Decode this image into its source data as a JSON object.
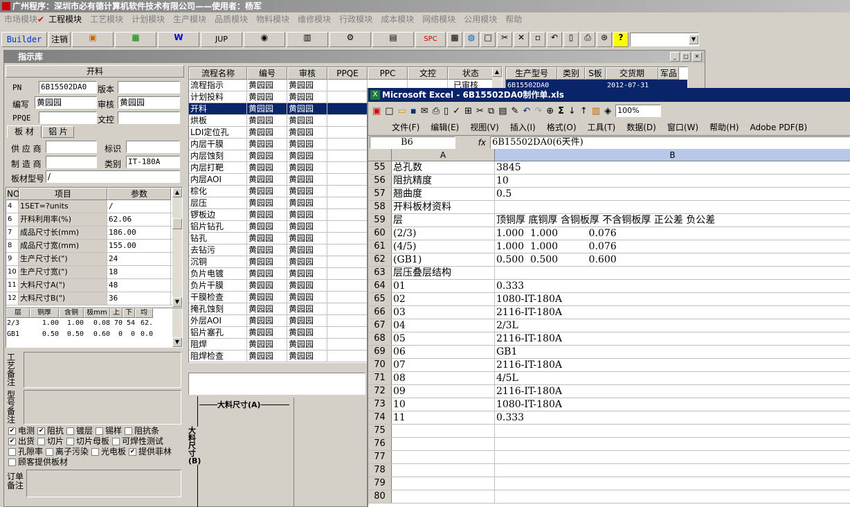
{
  "app": {
    "title": "广州程序：深圳市必有德计算机软件技术有限公司——使用者：杨军"
  },
  "menu": [
    "市场模块",
    "工程模块",
    "工艺模块",
    "计划模块",
    "生产模块",
    "品质模块",
    "物料模块",
    "维修模块",
    "行政模块",
    "成本模块",
    "网络模块",
    "公用模块",
    "帮助"
  ],
  "toolbar": {
    "builder": "Builder",
    "logout": "注销",
    "jup": "JUP",
    "spc": "SPC"
  },
  "lib": {
    "title": "指示库",
    "section": "开料",
    "pn_label": "PN",
    "pn_value": "6B15502DA0",
    "version_label": "版本",
    "author_label": "编写",
    "author_value": "黄园园",
    "review_label": "审核",
    "review_value": "黄园园",
    "ppqe_label": "PPQE",
    "doc_label": "文控",
    "tab1": "板 材",
    "tab2": "铝 片",
    "supplier_label": "供 应 商",
    "mark_label": "标识",
    "maker_label": "制 造 商",
    "class_label": "类别",
    "class_value": "IT-180A",
    "model_label": "板材型号",
    "model_value": "/",
    "params_header": [
      "NO",
      "项目",
      "参数"
    ],
    "params": [
      [
        "4",
        "1SET=?units",
        "/"
      ],
      [
        "6",
        "开料利用率(%)",
        "62.06"
      ],
      [
        "7",
        "成品尺寸长(mm)",
        "186.00"
      ],
      [
        "8",
        "成品尺寸宽(mm)",
        "155.00"
      ],
      [
        "9",
        "生产尺寸长(\")",
        "24"
      ],
      [
        "10",
        "生产尺寸宽(\")",
        "18"
      ],
      [
        "11",
        "大料尺寸A(\")",
        "48"
      ],
      [
        "12",
        "大料尺寸B(\")",
        "36"
      ]
    ],
    "layer_header": [
      "层",
      "铜厚(OZ)",
      "含铜mm",
      "极mm",
      "上",
      "下",
      "均"
    ],
    "layers": [
      [
        "2/3",
        "1.00",
        "1.00",
        "0.08",
        "70",
        "54",
        "62."
      ],
      [
        "GB1",
        "0.50",
        "0.50",
        "0.60",
        "0",
        "0",
        "0.0"
      ]
    ],
    "process_note_label": "工艺备注",
    "model_note_label": "型号备注",
    "checks": [
      [
        "电测",
        true
      ],
      [
        "阻抗",
        true
      ],
      [
        "镀层",
        false
      ],
      [
        "锡样",
        false
      ],
      [
        "阻抗条",
        false
      ],
      [
        "出货",
        true
      ],
      [
        "切片",
        false
      ],
      [
        "切片母板",
        false
      ],
      [
        "可焊性测试",
        false
      ],
      [
        "孔隙率",
        false
      ],
      [
        "离子污染",
        false
      ],
      [
        "光电板",
        false
      ],
      [
        "提供菲林",
        true
      ],
      [
        "顾客提供板材",
        false
      ]
    ],
    "order_note_label": "订单备注",
    "flow_header": [
      "流程名称",
      "编号",
      "审核",
      "PPQE",
      "PPC",
      "文控",
      "状态"
    ],
    "flows": [
      [
        "流程指示",
        "黄园园",
        "黄园园"
      ],
      [
        "计划投料",
        "黄园园",
        "黄园园"
      ],
      [
        "开料",
        "黄园园",
        "黄园园"
      ],
      [
        "烘板",
        "黄园园",
        "黄园园"
      ],
      [
        "LDI定位孔",
        "黄园园",
        "黄园园"
      ],
      [
        "内层干膜",
        "黄园园",
        "黄园园"
      ],
      [
        "内层蚀刻",
        "黄园园",
        "黄园园"
      ],
      [
        "内层打靶",
        "黄园园",
        "黄园园"
      ],
      [
        "内层AOI",
        "黄园园",
        "黄园园"
      ],
      [
        "棕化",
        "黄园园",
        "黄园园"
      ],
      [
        "层压",
        "黄园园",
        "黄园园"
      ],
      [
        "锣板边",
        "黄园园",
        "黄园园"
      ],
      [
        "铝片钻孔",
        "黄园园",
        "黄园园"
      ],
      [
        "钻孔",
        "黄园园",
        "黄园园"
      ],
      [
        "去钻污",
        "黄园园",
        "黄园园"
      ],
      [
        "沉铜",
        "黄园园",
        "黄园园"
      ],
      [
        "负片电镀",
        "黄园园",
        "黄园园"
      ],
      [
        "负片干膜",
        "黄园园",
        "黄园园"
      ],
      [
        "干膜检查",
        "黄园园",
        "黄园园"
      ],
      [
        "掩孔蚀刻",
        "黄园园",
        "黄园园"
      ],
      [
        "外层AOI",
        "黄园园",
        "黄园园"
      ],
      [
        "铝片塞孔",
        "黄园园",
        "黄园园"
      ],
      [
        "阻焊",
        "黄园园",
        "黄园园"
      ],
      [
        "阻焊检查",
        "黄园园",
        "黄园园"
      ]
    ],
    "flow_status_partial": "已审核",
    "diagram_a": "大料尺寸(A)",
    "diagram_b": "大料尺寸(B)",
    "right_header": [
      "生产型号",
      "类别",
      "S板",
      "交货期",
      "军品"
    ],
    "right_rows": [
      [
        "6B15502DA0",
        "",
        "",
        "2012-07-31",
        ""
      ]
    ]
  },
  "excel": {
    "title": "Microsoft Excel - 6B15502DA0制作单.xls",
    "menu": [
      "文件(F)",
      "编辑(E)",
      "视图(V)",
      "插入(I)",
      "格式(O)",
      "工具(T)",
      "数据(D)",
      "窗口(W)",
      "帮助(H)",
      "Adobe PDF(B)"
    ],
    "zoom": "100%",
    "cell_ref": "B6",
    "fx": "fx",
    "formula": "6B15502DA0(6天件)",
    "col_a": "A",
    "col_b": "B",
    "rows": [
      [
        "55",
        "总孔数",
        "3845"
      ],
      [
        "56",
        "阻抗精度",
        "10"
      ],
      [
        "57",
        "翘曲度",
        "0.5"
      ],
      [
        "58",
        "开料板材资料",
        ""
      ],
      [
        "59",
        "层",
        "顶铜厚 底铜厚 含铜板厚 不含铜板厚 正公差 负公差"
      ],
      [
        "60",
        "(2/3)",
        "1.000  1.000          0.076"
      ],
      [
        "61",
        "(4/5)",
        "1.000  1.000          0.076"
      ],
      [
        "62",
        "(GB1)",
        "0.500  0.500          0.600"
      ],
      [
        "63",
        "层压叠层结构",
        ""
      ],
      [
        "64",
        "01",
        "0.333"
      ],
      [
        "65",
        "02",
        "1080-IT-180A"
      ],
      [
        "66",
        "03",
        "2116-IT-180A"
      ],
      [
        "67",
        "04",
        "2/3L"
      ],
      [
        "68",
        "05",
        "2116-IT-180A"
      ],
      [
        "69",
        "06",
        "GB1"
      ],
      [
        "70",
        "07",
        "2116-IT-180A"
      ],
      [
        "71",
        "08",
        "4/5L"
      ],
      [
        "72",
        "09",
        "2116-IT-180A"
      ],
      [
        "73",
        "10",
        "1080-IT-180A"
      ],
      [
        "74",
        "11",
        "0.333"
      ],
      [
        "75",
        "",
        ""
      ],
      [
        "76",
        "",
        ""
      ],
      [
        "77",
        "",
        ""
      ],
      [
        "78",
        "",
        ""
      ],
      [
        "79",
        "",
        ""
      ],
      [
        "80",
        "",
        ""
      ]
    ]
  }
}
